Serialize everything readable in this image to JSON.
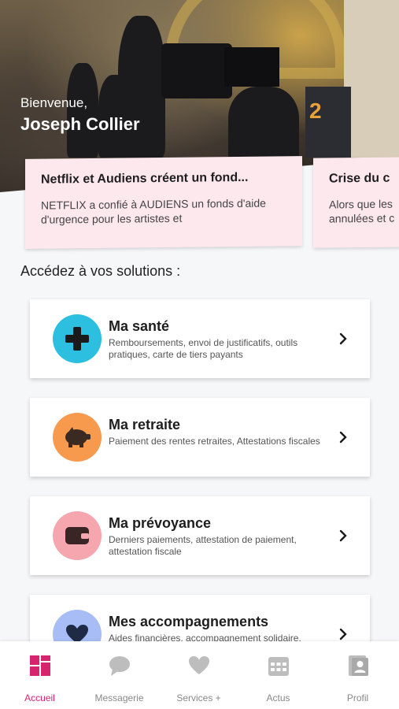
{
  "header": {
    "welcome": "Bienvenue,",
    "user_name": "Joseph Collier"
  },
  "news": [
    {
      "title": "Netflix et Audiens créent un fond...",
      "text": "NETFLIX a confié à AUDIENS un fonds d'aide d'urgence pour les artistes et"
    },
    {
      "title": "Crise du c",
      "text": "Alors que les annulées et c"
    }
  ],
  "solutions_title": "Accédez à vos solutions :",
  "solutions": [
    {
      "title": "Ma santé",
      "description": "Remboursements, envoi de justificatifs, outils pratiques, carte de tiers payants",
      "icon": "plus-icon",
      "color": "#2cbfe0"
    },
    {
      "title": "Ma retraite",
      "description": "Paiement des rentes retraites, Attestations fiscales",
      "icon": "piggy-bank-icon",
      "color": "#f79a4e"
    },
    {
      "title": "Ma prévoyance",
      "description": "Derniers paiements, attestation de paiement, attestation fiscale",
      "icon": "wallet-icon",
      "color": "#f6a6ae"
    },
    {
      "title": "Mes accompagnements",
      "description": "Aides financières, accompagnement solidaire,",
      "icon": "heart-icon",
      "color": "#a8bdf5"
    }
  ],
  "tabs": [
    {
      "label": "Accueil",
      "icon": "grid-icon",
      "active": true
    },
    {
      "label": "Messagerie",
      "icon": "chat-bubble-icon",
      "active": false
    },
    {
      "label": "Services +",
      "icon": "heart-icon",
      "active": false
    },
    {
      "label": "Actus",
      "icon": "calendar-icon",
      "active": false
    },
    {
      "label": "Profil",
      "icon": "profile-card-icon",
      "active": false
    }
  ],
  "colors": {
    "accent": "#d6246e",
    "inactive": "#bdbdbd",
    "news_bg": "#fde8ee"
  }
}
